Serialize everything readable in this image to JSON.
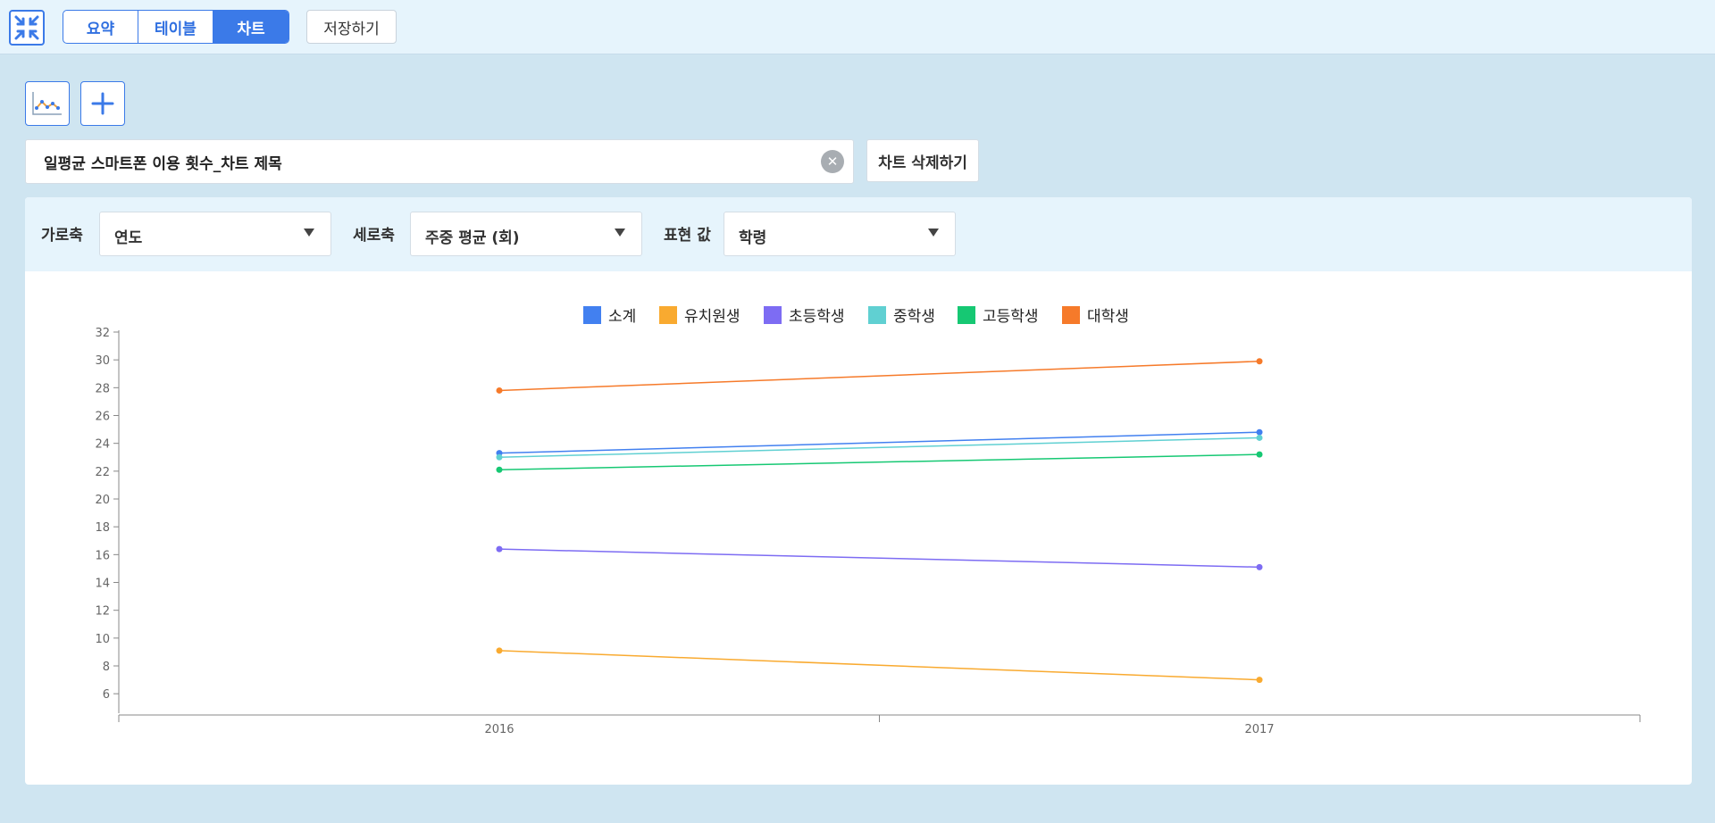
{
  "toolbar": {
    "tabs": [
      {
        "label": "요약",
        "active": false
      },
      {
        "label": "테이블",
        "active": false
      },
      {
        "label": "차트",
        "active": true
      }
    ],
    "save_label": "저장하기"
  },
  "chart_editor": {
    "title_value": "일평균 스마트폰 이용 횟수_차트 제목",
    "delete_label": "차트 삭제하기",
    "x_axis_label": "가로축",
    "x_axis_value": "연도",
    "y_axis_label": "세로축",
    "y_axis_value": "주중 평균 (회)",
    "series_label": "표현 값",
    "series_value": "학령"
  },
  "colors": {
    "accent": "#3b7ae8"
  },
  "chart_data": {
    "type": "line",
    "categories": [
      "2016",
      "2017"
    ],
    "series": [
      {
        "name": "소계",
        "color": "#4280f0",
        "values": [
          23.3,
          24.8
        ]
      },
      {
        "name": "유치원생",
        "color": "#f9aa30",
        "values": [
          9.1,
          7.0
        ]
      },
      {
        "name": "초등학생",
        "color": "#7d6cf3",
        "values": [
          16.4,
          15.1
        ]
      },
      {
        "name": "중학생",
        "color": "#60d0d2",
        "values": [
          23.0,
          24.4
        ]
      },
      {
        "name": "고등학생",
        "color": "#16c873",
        "values": [
          22.1,
          23.2
        ]
      },
      {
        "name": "대학생",
        "color": "#f67a2a",
        "values": [
          27.8,
          29.9
        ]
      }
    ],
    "ylim": [
      4.6,
      32
    ],
    "yticks": [
      6,
      8,
      10,
      12,
      14,
      16,
      18,
      20,
      22,
      24,
      26,
      28,
      30,
      32
    ],
    "legend": "top-center",
    "grid": false
  }
}
